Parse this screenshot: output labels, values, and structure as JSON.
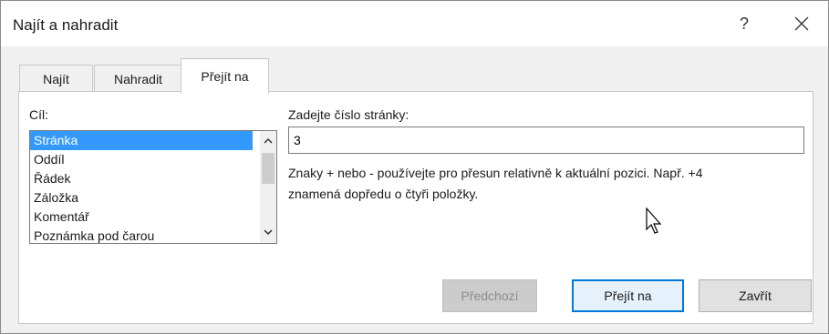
{
  "window": {
    "title": "Najít a nahradit",
    "help_label": "?"
  },
  "tabs": [
    {
      "label": "Najít",
      "active": false
    },
    {
      "label": "Nahradit",
      "active": false
    },
    {
      "label": "Přejít na",
      "active": true
    }
  ],
  "goto": {
    "target_label": "Cíl:",
    "targets": [
      "Stránka",
      "Oddíl",
      "Řádek",
      "Záložka",
      "Komentář",
      "Poznámka pod čarou"
    ],
    "selected_target": "Stránka",
    "page_label": "Zadejte číslo stránky:",
    "page_value": "3",
    "hint_line1": "Znaky + nebo - používejte pro přesun relativně k aktuální pozici. Např. +4",
    "hint_line2": "znamená dopředu o čtyři položky."
  },
  "buttons": {
    "previous": "Předchozí",
    "goto": "Přejít na",
    "close": "Zavřít"
  },
  "colors": {
    "selection": "#3399ff",
    "default_button_border": "#0078d7"
  }
}
